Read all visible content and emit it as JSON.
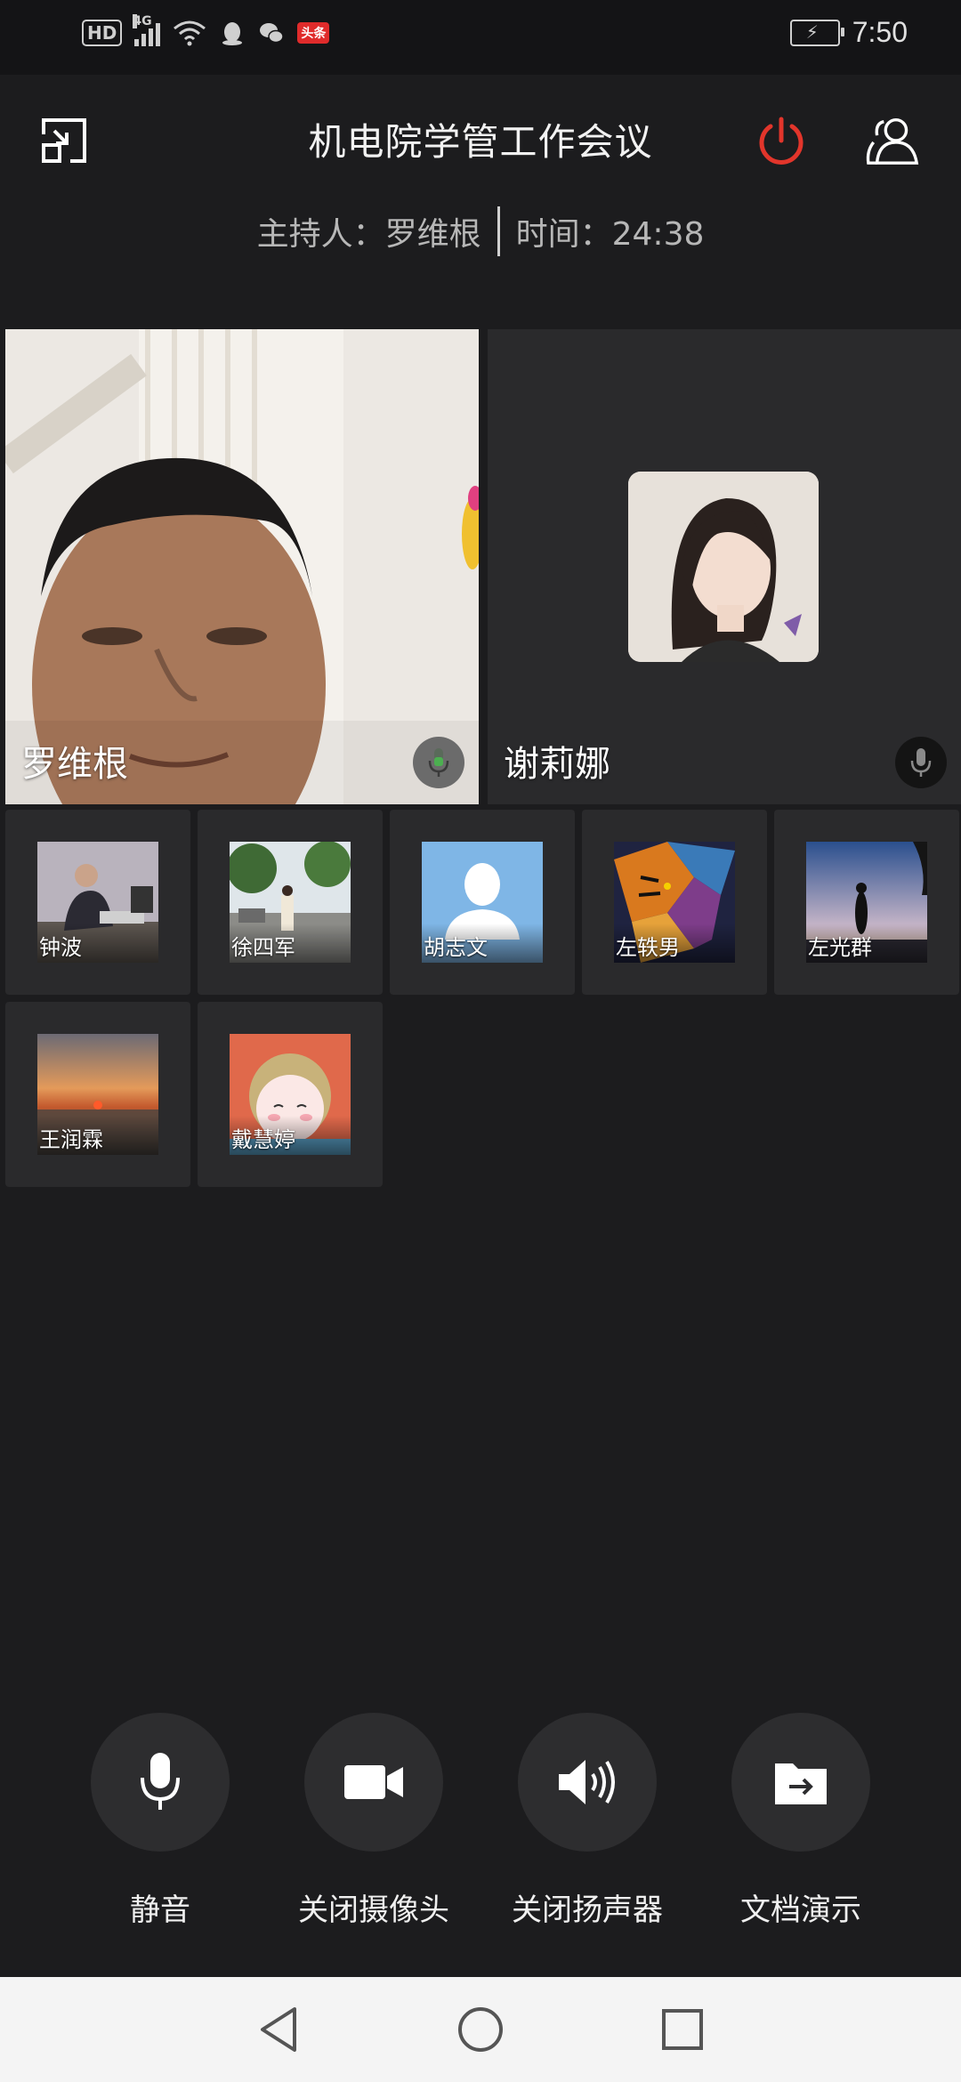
{
  "status_bar": {
    "time": "7:50",
    "hd_label": "HD",
    "network_label": "4G",
    "app_badge": "头条"
  },
  "header": {
    "title": "机电院学管工作会议",
    "host_label": "主持人：罗维根",
    "time_label": "时间：24:38",
    "power_color": "#e2352b"
  },
  "main_videos": [
    {
      "name": "罗维根",
      "mic": "speaking"
    },
    {
      "name": "谢莉娜",
      "mic": "idle"
    }
  ],
  "participants": [
    {
      "name": "钟波",
      "thumb": "office-photo"
    },
    {
      "name": "徐四军",
      "thumb": "street-photo"
    },
    {
      "name": "胡志文",
      "thumb": "default-avatar"
    },
    {
      "name": "左轶男",
      "thumb": "tiger-art"
    },
    {
      "name": "左光群",
      "thumb": "beach-silhouette"
    },
    {
      "name": "王润霖",
      "thumb": "sunset-sea"
    },
    {
      "name": "戴慧婷",
      "thumb": "anime-child"
    }
  ],
  "controls": [
    {
      "label": "静音",
      "icon": "microphone-icon"
    },
    {
      "label": "关闭摄像头",
      "icon": "camera-icon"
    },
    {
      "label": "关闭扬声器",
      "icon": "speaker-icon"
    },
    {
      "label": "文档演示",
      "icon": "folder-share-icon"
    }
  ],
  "nav": {
    "back_icon": "back-triangle-icon",
    "home_icon": "home-circle-icon",
    "recents_icon": "recents-square-icon"
  }
}
